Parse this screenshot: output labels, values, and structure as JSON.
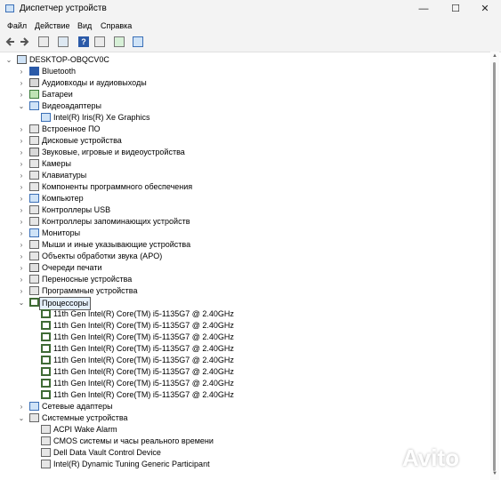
{
  "window": {
    "title": "Диспетчер устройств",
    "minimize": "—",
    "maximize": "☐",
    "close": "✕"
  },
  "menu": [
    "Файл",
    "Действие",
    "Вид",
    "Справка"
  ],
  "toolbar": [
    "back-icon",
    "forward-icon",
    "properties-icon",
    "view-icon",
    "help-icon",
    "update-driver-icon",
    "monitor-icon"
  ],
  "tree": {
    "root": "DESKTOP-OBQCV0C",
    "rows": [
      {
        "label": "Bluetooth",
        "icon": "bluetooth-icon",
        "level": 1,
        "exp": "›"
      },
      {
        "label": "Аудиовходы и аудиовыходы",
        "icon": "audio-icon",
        "level": 1,
        "exp": "›"
      },
      {
        "label": "Батареи",
        "icon": "battery-icon",
        "level": 1,
        "exp": "›"
      },
      {
        "label": "Видеоадаптеры",
        "icon": "display-adapter-icon",
        "level": 1,
        "exp": "⌄"
      },
      {
        "label": "Intel(R) Iris(R) Xe Graphics",
        "icon": "display-adapter-icon",
        "level": 2,
        "exp": ""
      },
      {
        "label": "Встроенное ПО",
        "icon": "firmware-icon",
        "level": 1,
        "exp": "›"
      },
      {
        "label": "Дисковые устройства",
        "icon": "disk-icon",
        "level": 1,
        "exp": "›"
      },
      {
        "label": "Звуковые, игровые и видеоустройства",
        "icon": "sound-icon",
        "level": 1,
        "exp": "›"
      },
      {
        "label": "Камеры",
        "icon": "camera-icon",
        "level": 1,
        "exp": "›"
      },
      {
        "label": "Клавиатуры",
        "icon": "keyboard-icon",
        "level": 1,
        "exp": "›"
      },
      {
        "label": "Компоненты программного обеспечения",
        "icon": "software-component-icon",
        "level": 1,
        "exp": "›"
      },
      {
        "label": "Компьютер",
        "icon": "computer-icon",
        "level": 1,
        "exp": "›"
      },
      {
        "label": "Контроллеры USB",
        "icon": "usb-icon",
        "level": 1,
        "exp": "›"
      },
      {
        "label": "Контроллеры запоминающих устройств",
        "icon": "storage-controller-icon",
        "level": 1,
        "exp": "›"
      },
      {
        "label": "Мониторы",
        "icon": "monitor-icon",
        "level": 1,
        "exp": "›"
      },
      {
        "label": "Мыши и иные указывающие устройства",
        "icon": "mouse-icon",
        "level": 1,
        "exp": "›"
      },
      {
        "label": "Объекты обработки звука (APO)",
        "icon": "audio-processing-icon",
        "level": 1,
        "exp": "›"
      },
      {
        "label": "Очереди печати",
        "icon": "printer-icon",
        "level": 1,
        "exp": "›"
      },
      {
        "label": "Переносные устройства",
        "icon": "portable-device-icon",
        "level": 1,
        "exp": "›"
      },
      {
        "label": "Программные устройства",
        "icon": "software-device-icon",
        "level": 1,
        "exp": "›"
      },
      {
        "label": "Процессоры",
        "icon": "processor-icon",
        "level": 1,
        "exp": "⌄",
        "selected": true
      },
      {
        "label": "11th Gen Intel(R) Core(TM) i5-1135G7 @ 2.40GHz",
        "icon": "processor-icon",
        "level": 2,
        "exp": ""
      },
      {
        "label": "11th Gen Intel(R) Core(TM) i5-1135G7 @ 2.40GHz",
        "icon": "processor-icon",
        "level": 2,
        "exp": ""
      },
      {
        "label": "11th Gen Intel(R) Core(TM) i5-1135G7 @ 2.40GHz",
        "icon": "processor-icon",
        "level": 2,
        "exp": ""
      },
      {
        "label": "11th Gen Intel(R) Core(TM) i5-1135G7 @ 2.40GHz",
        "icon": "processor-icon",
        "level": 2,
        "exp": ""
      },
      {
        "label": "11th Gen Intel(R) Core(TM) i5-1135G7 @ 2.40GHz",
        "icon": "processor-icon",
        "level": 2,
        "exp": ""
      },
      {
        "label": "11th Gen Intel(R) Core(TM) i5-1135G7 @ 2.40GHz",
        "icon": "processor-icon",
        "level": 2,
        "exp": ""
      },
      {
        "label": "11th Gen Intel(R) Core(TM) i5-1135G7 @ 2.40GHz",
        "icon": "processor-icon",
        "level": 2,
        "exp": ""
      },
      {
        "label": "11th Gen Intel(R) Core(TM) i5-1135G7 @ 2.40GHz",
        "icon": "processor-icon",
        "level": 2,
        "exp": ""
      },
      {
        "label": "Сетевые адаптеры",
        "icon": "network-adapter-icon",
        "level": 1,
        "exp": "›"
      },
      {
        "label": "Системные устройства",
        "icon": "system-device-icon",
        "level": 1,
        "exp": "⌄"
      },
      {
        "label": "ACPI Wake Alarm",
        "icon": "system-device-icon",
        "level": 2,
        "exp": ""
      },
      {
        "label": "CMOS системы и часы реального времени",
        "icon": "system-device-icon",
        "level": 2,
        "exp": ""
      },
      {
        "label": "Dell Data Vault Control Device",
        "icon": "system-device-icon",
        "level": 2,
        "exp": ""
      },
      {
        "label": "Intel(R) Dynamic Tuning Generic Participant",
        "icon": "system-device-icon",
        "level": 2,
        "exp": ""
      }
    ]
  },
  "watermark": "Avito",
  "colors": {
    "chrome": "#f3f3f3",
    "selection": "#e5f0fb",
    "accent": "#3b6fb6",
    "cpu": "#3f6b35"
  }
}
